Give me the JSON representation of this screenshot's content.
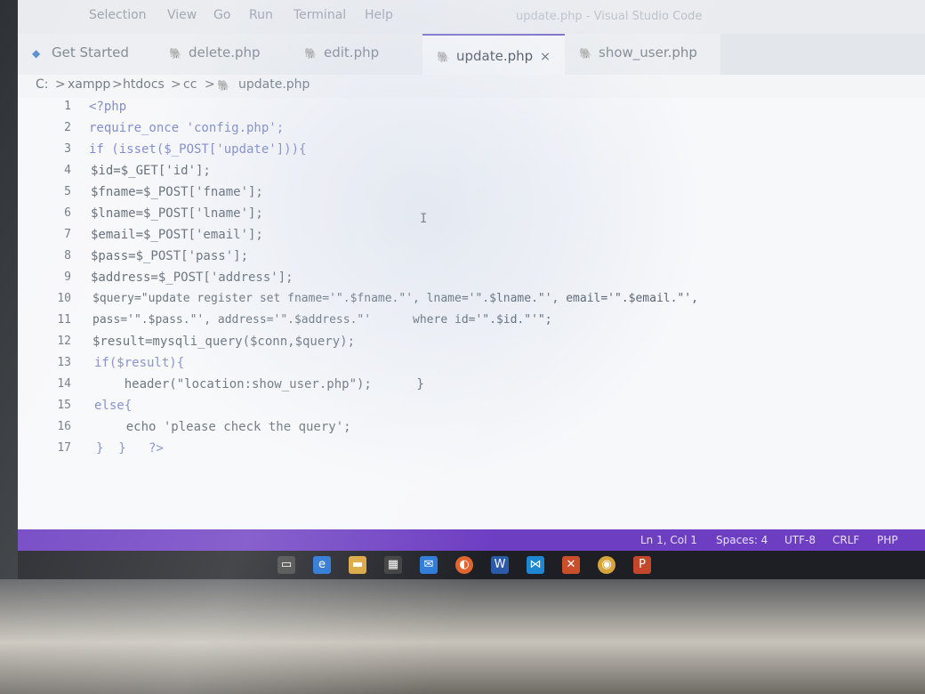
{
  "menubar": {
    "items": [
      "Selection",
      "View",
      "Go",
      "Run",
      "Terminal",
      "Help"
    ],
    "window_title": "update.php - Visual Studio Code"
  },
  "tabs": [
    {
      "label": "Get Started",
      "active": false
    },
    {
      "label": "delete.php",
      "active": false
    },
    {
      "label": "edit.php",
      "active": false
    },
    {
      "label": "update.php",
      "active": true,
      "close": "×"
    },
    {
      "label": "show_user.php",
      "active": false
    }
  ],
  "breadcrumb": {
    "items": [
      "C:",
      ">",
      "xampp",
      ">",
      "htdocs",
      ">",
      "cc",
      ">",
      "update.php"
    ]
  },
  "editor": {
    "line_numbers": [
      "1",
      "2",
      "3",
      "4",
      "5",
      "6",
      "7",
      "8",
      "9",
      "10",
      "11",
      "12",
      "13",
      "14",
      "15",
      "16",
      "17"
    ],
    "lines": [
      "<?php",
      "require_once 'config.php';",
      "if (isset($_POST['update'])){",
      "$id=$_GET['id'];",
      "$fname=$_POST['fname'];",
      "$lname=$_POST['lname'];",
      "$email=$_POST['email'];",
      "$pass=$_POST['pass'];",
      "$address=$_POST['address'];",
      "$query=\"update register set fname='\".$fname.\"', lname='\".$lname.\"', email='\".$email.\"',",
      "pass='\".$pass.\"', address='\".$address.\"'      where id='\".$id.\"'\";",
      "$result=mysqli_query($conn,$query);",
      "if($result){",
      "    header(\"location:show_user.php\");      }",
      "else{",
      "    echo 'please check the query';",
      "}  }   ?>"
    ]
  },
  "statusbar": {
    "position": "Ln 1, Col 1",
    "spaces": "Spaces: 4",
    "encoding": "UTF-8",
    "eol": "CRLF",
    "language": "PHP"
  },
  "taskbar": {
    "icons": [
      "task-view-icon",
      "edge-icon",
      "file-explorer-icon",
      "store-icon",
      "mail-icon",
      "firefox-icon",
      "word-icon",
      "vscode-icon",
      "xampp-icon",
      "chrome-icon",
      "powerpoint-icon"
    ]
  },
  "colors": {
    "accent": "#6d3ec2",
    "editor_bg": "#f7f8fa",
    "keyword": "#7a86c8",
    "string": "#a0606a",
    "variable": "#3f6fb5"
  }
}
